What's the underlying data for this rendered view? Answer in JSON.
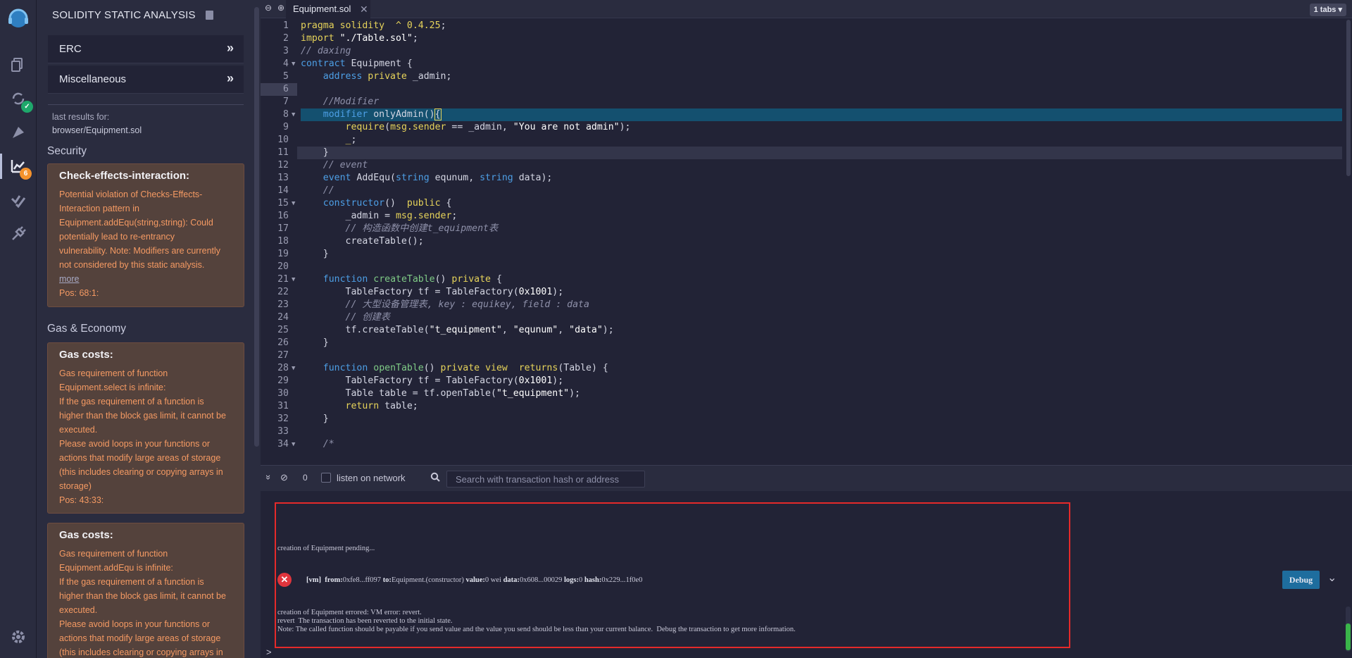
{
  "rail": {
    "badges": {
      "analysis_count": "6"
    }
  },
  "panel": {
    "title": "SOLIDITY STATIC ANALYSIS",
    "categories": [
      {
        "label": "ERC",
        "chevron": "»"
      },
      {
        "label": "Miscellaneous",
        "chevron": "»"
      }
    ],
    "last_results_label": "last results for:",
    "last_results_file": "browser/Equipment.sol",
    "sections": {
      "security": "Security",
      "gas": "Gas & Economy"
    },
    "cards": [
      {
        "title": "Check-effects-interaction:",
        "lines": [
          "Potential violation of Checks-Effects-",
          "Interaction pattern in",
          "Equipment.addEqu(string,string): Could",
          "potentially lead to re-entrancy",
          "vulnerability. Note: Modifiers are currently",
          "not considered by this static analysis."
        ],
        "more": "more",
        "pos": "Pos: 68:1:"
      },
      {
        "title": "Gas costs:",
        "lines": [
          "Gas requirement of function",
          "Equipment.select is infinite:",
          "If the gas requirement of a function is",
          "higher than the block gas limit, it cannot be",
          "executed.",
          "Please avoid loops in your functions or",
          "actions that modify large areas of storage",
          "(this includes clearing or copying arrays in",
          "storage)"
        ],
        "pos": "Pos: 43:33:"
      },
      {
        "title": "Gas costs:",
        "lines": [
          "Gas requirement of function",
          "Equipment.addEqu is infinite:",
          "If the gas requirement of a function is",
          "higher than the block gas limit, it cannot be",
          "executed.",
          "Please avoid loops in your functions or",
          "actions that modify large areas of storage",
          "(this includes clearing or copying arrays in"
        ]
      }
    ]
  },
  "editor": {
    "zoom_out": "⊖",
    "zoom_in": "⊕",
    "tab_name": "Equipment.sol",
    "tab_close": "✕",
    "tabs_count": "1 tabs ▾",
    "line_numbers": [
      "1",
      "2",
      "3",
      "4",
      "5",
      "6",
      "7",
      "8",
      "9",
      "10",
      "11",
      "12",
      "13",
      "14",
      "15",
      "16",
      "17",
      "18",
      "19",
      "20",
      "21",
      "22",
      "23",
      "24",
      "25",
      "26",
      "27",
      "28",
      "29",
      "30",
      "31",
      "32",
      "33",
      "34"
    ]
  },
  "terminal": {
    "collapse_icon": "»",
    "clear_icon": "⊘",
    "counter": "0",
    "listen_label": "listen on network",
    "search_placeholder": "Search with transaction hash or address",
    "pending": "creation of Equipment pending...",
    "tx": {
      "vm": "[vm]",
      "from_label": "from:",
      "from_val": "0xfe8...ff097",
      "to_label": "to:",
      "to_val": "Equipment.(constructor)",
      "value_label": "value:",
      "value_val": "0 wei",
      "data_label": "data:",
      "data_val": "0x608...00029",
      "logs_label": "logs:",
      "logs_val": "0",
      "hash_label": "hash:",
      "hash_val": "0x229...1f0e0"
    },
    "debug_label": "Debug",
    "error_lines": [
      "creation of Equipment errored: VM error: revert.",
      "revert  The transaction has been reverted to the initial state.",
      "Note: The called function should be payable if you send value and the value you send should be less than your current balance.  Debug the transaction to get more information."
    ],
    "prompt": ">"
  }
}
